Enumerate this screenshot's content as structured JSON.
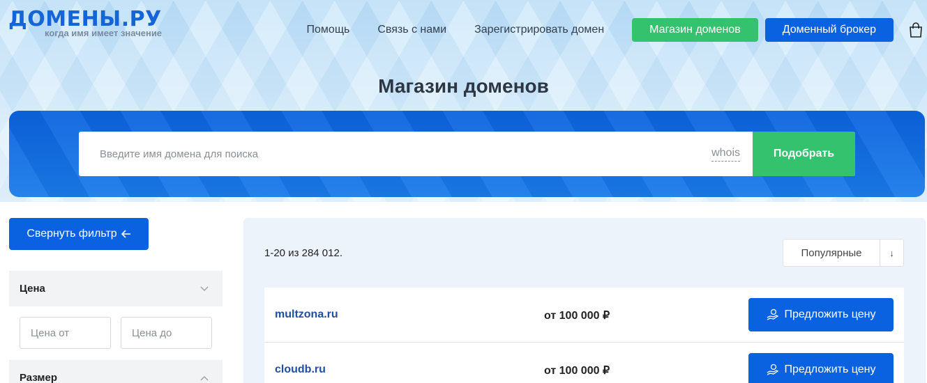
{
  "header": {
    "logo_title": "ДОМЕНЫ.РУ",
    "logo_tagline": "когда имя имеет значение",
    "nav": [
      "Помощь",
      "Связь с нами",
      "Зарегистрировать домен"
    ],
    "shop_button": "Магазин доменов",
    "broker_button": "Доменный брокер",
    "cart_icon": "shopping-bag-icon"
  },
  "page_title": "Магазин доменов",
  "search": {
    "placeholder": "Введите имя домена для поиска",
    "value": "",
    "whois": "whois",
    "submit": "Подобрать"
  },
  "filters": {
    "collapse_button": "Свернуть фильтр",
    "collapse_icon": "arrow-left-icon",
    "price_heading": "Цена",
    "price_from_placeholder": "Цена от",
    "price_to_placeholder": "Цена до",
    "size_heading": "Размер"
  },
  "results": {
    "count": "1-20 из 284 012.",
    "sort_label": "Популярные",
    "sort_arrow": "↓",
    "items": [
      {
        "domain": "multzona.ru",
        "price": "от 100 000 ₽",
        "action": "Предложить цену"
      },
      {
        "domain": "cloudb.ru",
        "price": "от 100 000 ₽",
        "action": "Предложить цену"
      }
    ]
  },
  "colors": {
    "primary_blue": "#0a62e0",
    "accent_green": "#34c26f",
    "link_blue": "#1f4fa0"
  }
}
